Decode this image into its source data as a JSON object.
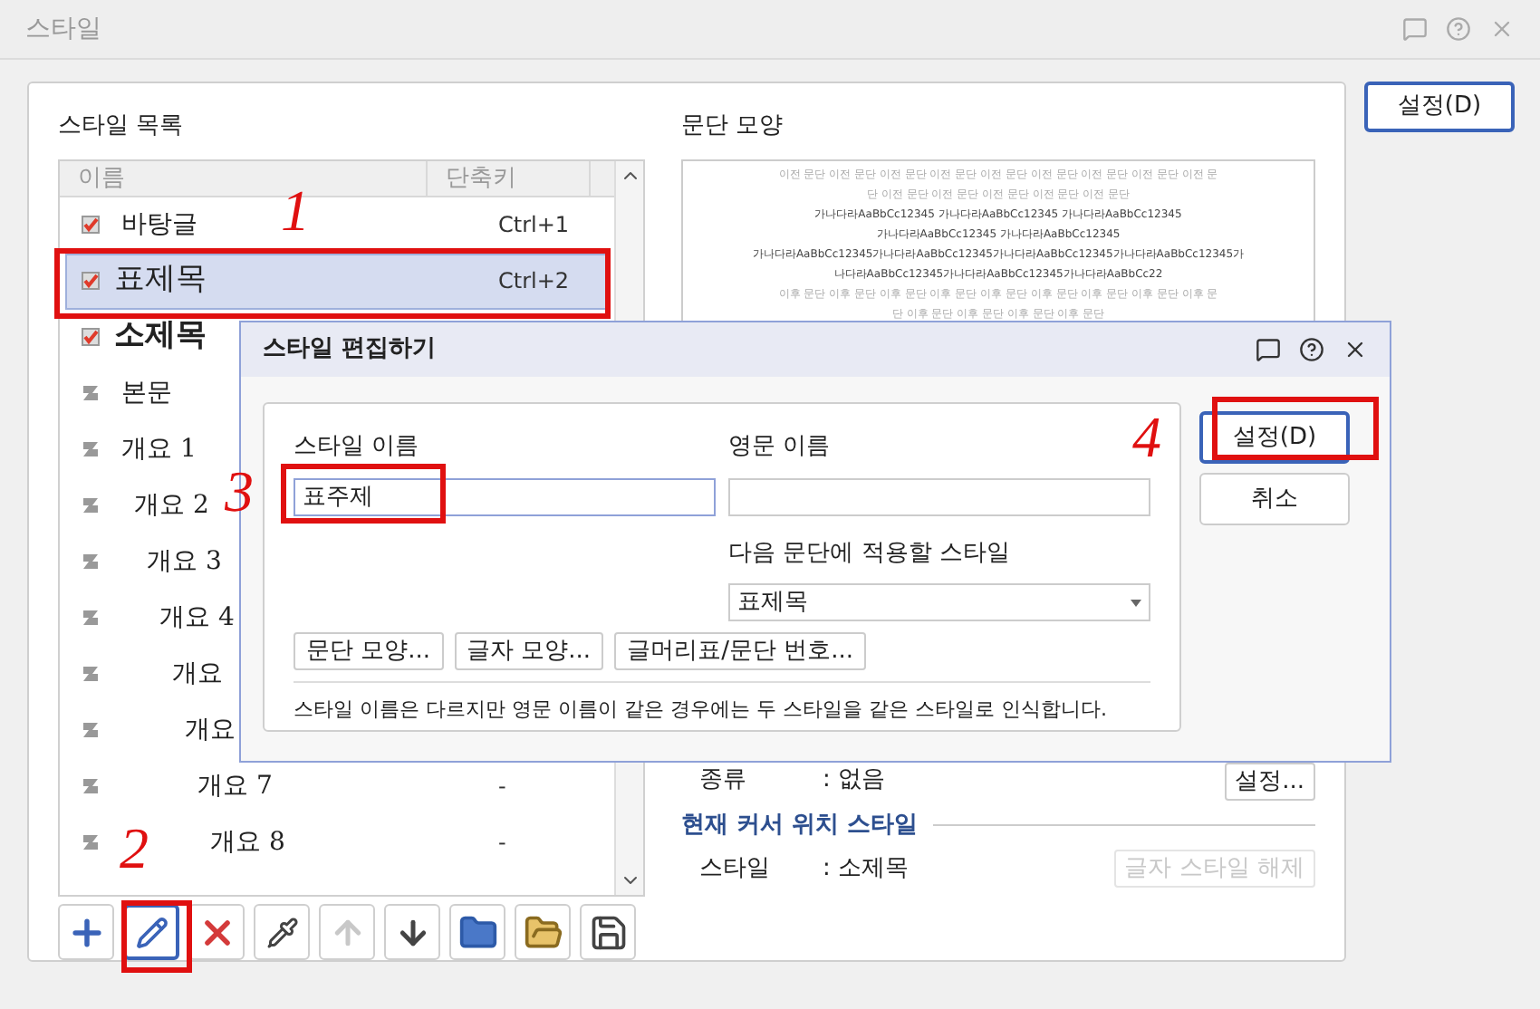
{
  "window": {
    "title": "스타일"
  },
  "main_button": {
    "label": "설정(D)"
  },
  "style_list": {
    "title": "스타일 목록",
    "columns": [
      "이름",
      "단축키"
    ],
    "rows": [
      {
        "name": "바탕글",
        "shortcut": "Ctrl+1",
        "kind": "check",
        "selected": false
      },
      {
        "name": "표제목",
        "shortcut": "Ctrl+2",
        "kind": "check-large",
        "selected": true
      },
      {
        "name": "소제목",
        "kind": "check-bold",
        "selected": false
      },
      {
        "name": "본문",
        "kind": "level",
        "selected": false
      },
      {
        "name": "개요 1",
        "kind": "outline",
        "selected": false
      },
      {
        "name": "개요 2",
        "kind": "outline",
        "selected": false
      },
      {
        "name": "개요 3",
        "kind": "outline",
        "selected": false
      },
      {
        "name": "개요 4",
        "kind": "outline",
        "selected": false
      },
      {
        "name": "개요",
        "kind": "outline",
        "selected": false
      },
      {
        "name": "개요",
        "kind": "outline",
        "selected": false
      },
      {
        "name": "개요 7",
        "shortcut": "-",
        "kind": "outline",
        "selected": false
      },
      {
        "name": "개요 8",
        "shortcut": "-",
        "kind": "outline",
        "selected": false
      }
    ]
  },
  "toolbar": [
    {
      "kind": "add",
      "disabled": false,
      "selected": false
    },
    {
      "kind": "edit",
      "disabled": false,
      "selected": true
    },
    {
      "kind": "delete",
      "disabled": false,
      "selected": false
    },
    {
      "kind": "pick",
      "disabled": false,
      "selected": false
    },
    {
      "kind": "up",
      "disabled": true,
      "selected": false
    },
    {
      "kind": "down",
      "disabled": false,
      "selected": false
    },
    {
      "kind": "import",
      "disabled": false,
      "selected": false
    },
    {
      "kind": "open",
      "disabled": false,
      "selected": false
    },
    {
      "kind": "save",
      "disabled": false,
      "selected": false
    }
  ],
  "preview": {
    "title": "문단 모양",
    "lines": [
      {
        "text": "이전 문단 이전 문단 이전 문단 이전 문단 이전 문단 이전 문단 이전 문단 이전 문단 이전 문",
        "kind": "context"
      },
      {
        "text": "단 이전 문단 이전 문단 이전 문단 이전 문단 이전 문단",
        "kind": "context"
      },
      {
        "text": "가나다라AaBbCc12345 가나다라AaBbCc12345 가나다라AaBbCc12345",
        "kind": "sample"
      },
      {
        "text": "가나다라AaBbCc12345 가나다라AaBbCc12345",
        "kind": "sample"
      },
      {
        "text": "가나다라AaBbCc12345가나다라AaBbCc12345가나다라AaBbCc12345가나다라AaBbCc12345가",
        "kind": "sample"
      },
      {
        "text": "나다라AaBbCc12345가나다라AaBbCc12345가나다라AaBbCc22",
        "kind": "sample"
      },
      {
        "text": "이후 문단 이후 문단 이후 문단 이후 문단 이후 문단 이후 문단 이후 문단 이후 문단 이후 문",
        "kind": "context"
      },
      {
        "text": "단 이후 문단 이후 문단 이후 문단 이후 문단",
        "kind": "context"
      }
    ]
  },
  "numbering": {
    "label": "종류",
    "value": ": 없음",
    "button": "설정..."
  },
  "cursor_style": {
    "heading": "현재 커서 위치 스타일",
    "label": "스타일",
    "value": ": 소제목",
    "button": {
      "label": "글자 스타일 해제",
      "disabled": true
    }
  },
  "edit_dialog": {
    "title": "스타일 편집하기",
    "style_name": {
      "label": "스타일 이름",
      "value": "표주제"
    },
    "english_name": {
      "label": "영문 이름"
    },
    "next_style": {
      "label": "다음 문단에 적용할 스타일",
      "value": "표제목"
    },
    "buttons": [
      "문단 모양...",
      "글자 모양...",
      "글머리표/문단 번호..."
    ],
    "note": "스타일 이름은 다르지만 영문 이름이 같은 경우에는 두 스타일을 같은 스타일로 인식합니다.",
    "ok": "설정(D)",
    "cancel": "취소"
  },
  "annotations": [
    "1",
    "2",
    "3",
    "4"
  ]
}
